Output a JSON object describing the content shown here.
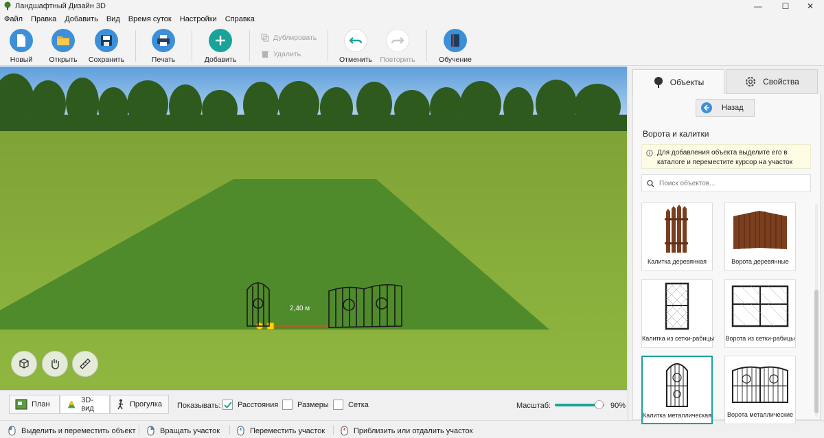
{
  "window": {
    "title": "Ландшафтный Дизайн 3D",
    "controls": [
      "—",
      "☐",
      "✕"
    ]
  },
  "menu": [
    "Файл",
    "Правка",
    "Добавить",
    "Вид",
    "Время суток",
    "Настройки",
    "Справка"
  ],
  "toolbar": {
    "new_label": "Новый",
    "open_label": "Открыть",
    "save_label": "Сохранить",
    "print_label": "Печать",
    "add_label": "Добавить",
    "duplicate_label": "Дублировать",
    "delete_label": "Удалить",
    "undo_label": "Отменить",
    "redo_label": "Повторить",
    "learn_label": "Обучение",
    "accent_color": "#1aa39a",
    "blue_color": "#3d8fd8"
  },
  "viewport": {
    "distance_label": "2,40 м",
    "buttons": [
      "cube-rotate-icon",
      "hand-icon",
      "ruler-icon"
    ]
  },
  "bottom_bar": {
    "tabs": [
      "План",
      "3D-вид",
      "Прогулка"
    ],
    "active_tab": "3D-вид",
    "show_label": "Показывать:",
    "checkboxes": [
      {
        "label": "Расстояния",
        "checked": true
      },
      {
        "label": "Размеры",
        "checked": false
      },
      {
        "label": "Сетка",
        "checked": false
      }
    ],
    "scale_label": "Масштаб:",
    "scale_value": "90%",
    "scale_fraction": 0.9
  },
  "status_bar": {
    "hints": [
      "Выделить и переместить объект",
      "Вращать участок",
      "Переместить участок",
      "Приблизить или отдалить участок"
    ]
  },
  "panel": {
    "tabs": [
      "Объекты",
      "Свойства"
    ],
    "active_tab": "Объекты",
    "back_label": "Назад",
    "section_title": "Ворота и калитки",
    "info_text": "Для добавления объекта выделите его в каталоге и переместите курсор на участок",
    "search_placeholder": "Поиск объектов...",
    "items": [
      {
        "label": "Калитка деревянная",
        "selected": false
      },
      {
        "label": "Ворота деревянные",
        "selected": false
      },
      {
        "label": "Калитка из сетки-рабицы",
        "selected": false
      },
      {
        "label": "Ворота из сетки-рабицы",
        "selected": false
      },
      {
        "label": "Калитка металлическая",
        "selected": true
      },
      {
        "label": "Ворота металлические",
        "selected": false
      }
    ]
  }
}
